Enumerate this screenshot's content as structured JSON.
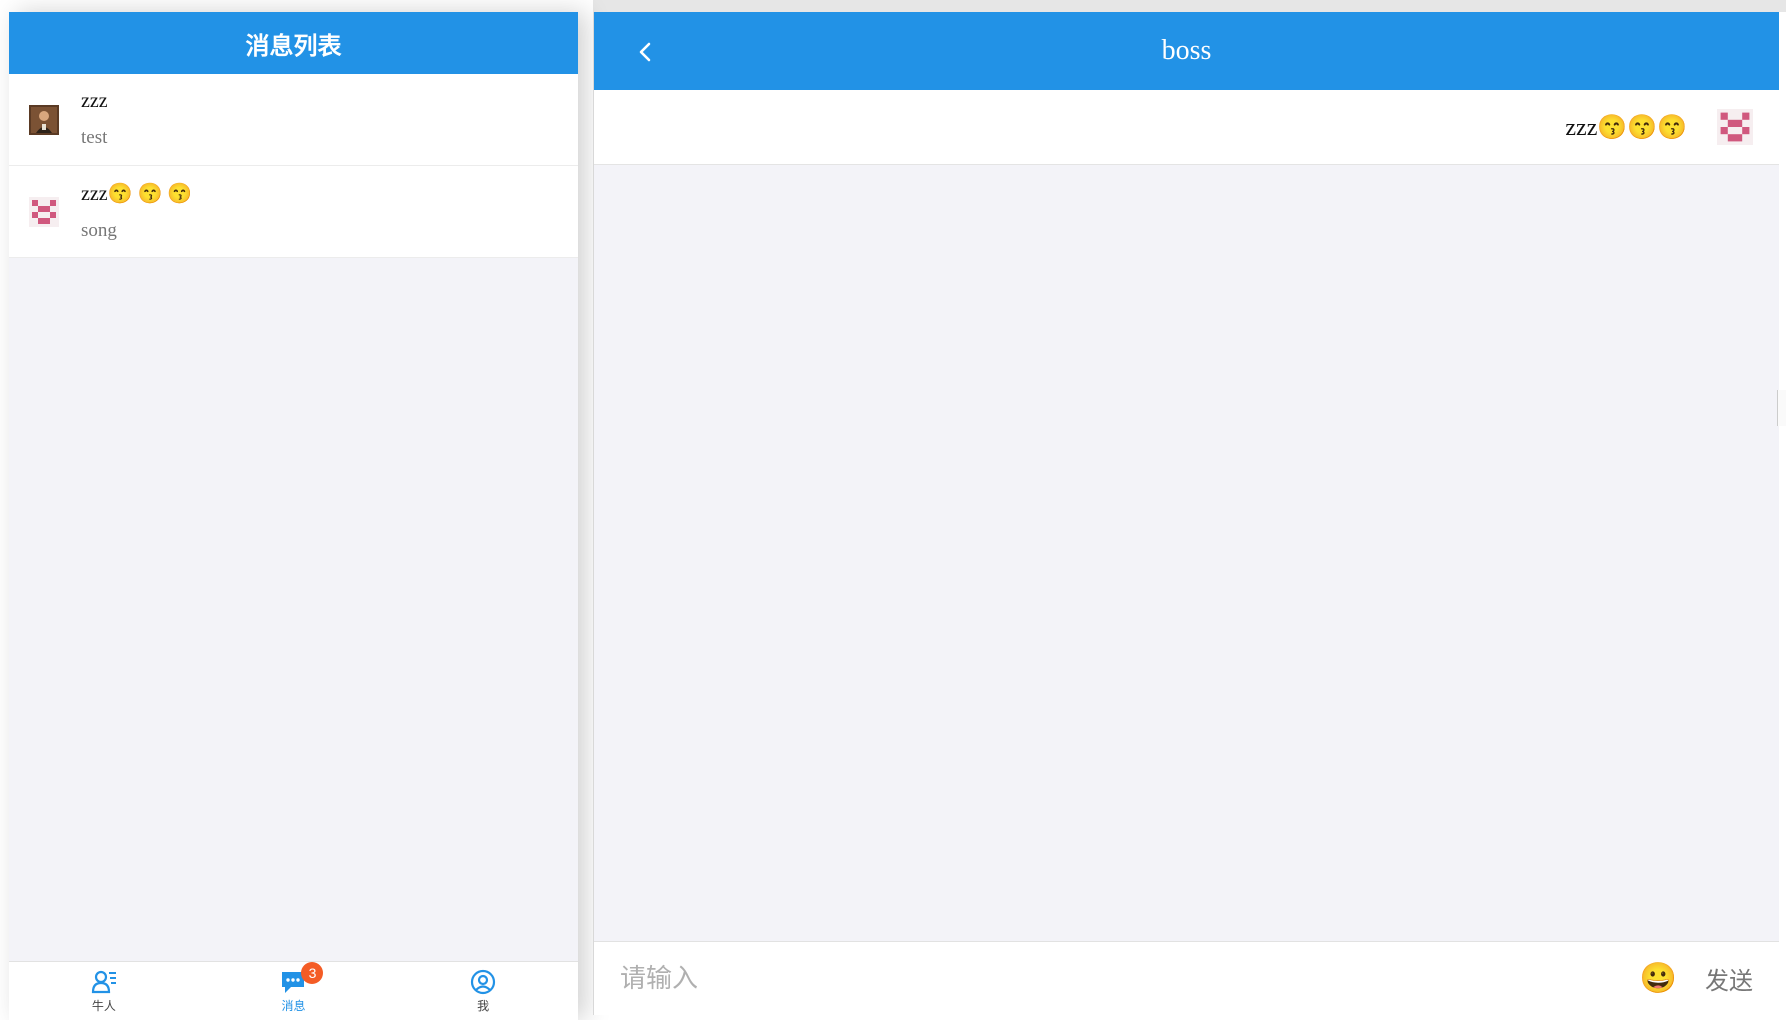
{
  "left": {
    "title": "消息列表",
    "items": [
      {
        "name": "zzz",
        "sub": "test"
      },
      {
        "name": "zzz😙 😙 😙",
        "sub": "song"
      }
    ],
    "tabs": [
      {
        "label": "牛人",
        "icon": "person-list-icon"
      },
      {
        "label": "消息",
        "icon": "chat-icon",
        "badge": "3"
      },
      {
        "label": "我",
        "icon": "user-circle-icon"
      }
    ]
  },
  "chat": {
    "title": "boss",
    "messages": [
      {
        "text": "zzz😙😙😙"
      }
    ],
    "input_placeholder": "请输入",
    "emoji": "😀",
    "send_label": "发送"
  },
  "colors": {
    "accent": "#2292e6",
    "badge": "#f45c25",
    "background": "#f3f3f8"
  }
}
